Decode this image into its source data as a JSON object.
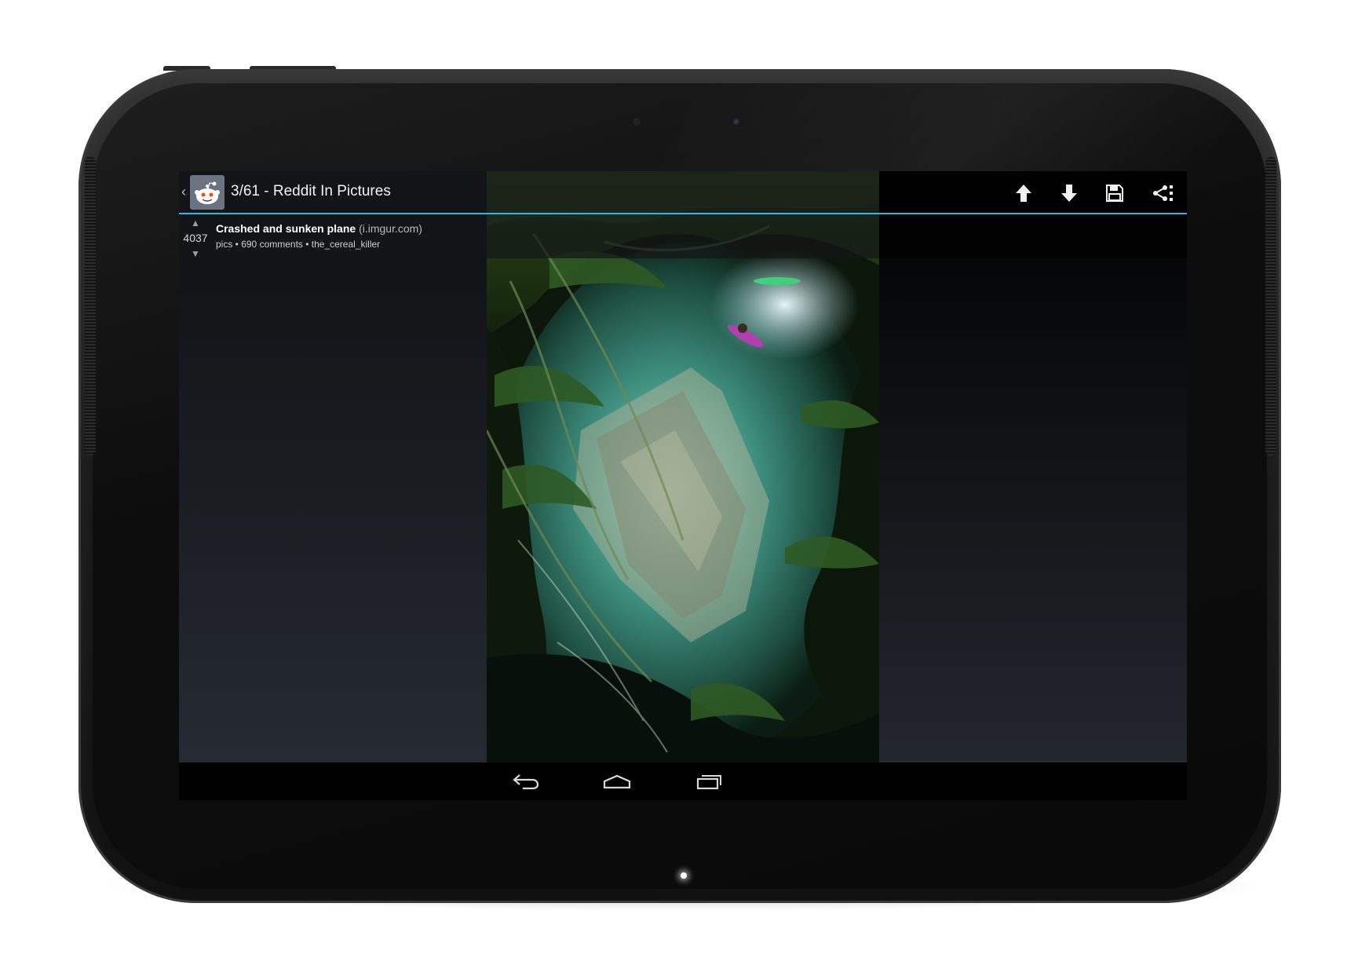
{
  "action_bar": {
    "title": "3/61 - Reddit In Pictures",
    "up_caret": "‹",
    "app_icon": "reddit-alien-icon",
    "actions": [
      {
        "name": "upvote-button",
        "icon": "arrow-up-icon"
      },
      {
        "name": "downvote-button",
        "icon": "arrow-down-icon"
      },
      {
        "name": "save-button",
        "icon": "floppy-disk-icon"
      },
      {
        "name": "share-button",
        "icon": "share-icon"
      },
      {
        "name": "overflow-menu-button",
        "icon": "more-vertical-icon"
      }
    ],
    "accent_color": "#33b5e5"
  },
  "post": {
    "score": "4037",
    "title": "Crashed and sunken plane",
    "domain": "(i.imgur.com)",
    "meta": "pics • 690 comments • the_cereal_killer",
    "vote_up_glyph": "▲",
    "vote_down_glyph": "▼"
  },
  "nav_bar": {
    "buttons": [
      {
        "name": "back-button",
        "icon": "back-icon"
      },
      {
        "name": "home-button",
        "icon": "home-icon"
      },
      {
        "name": "recents-button",
        "icon": "recents-icon"
      }
    ]
  }
}
